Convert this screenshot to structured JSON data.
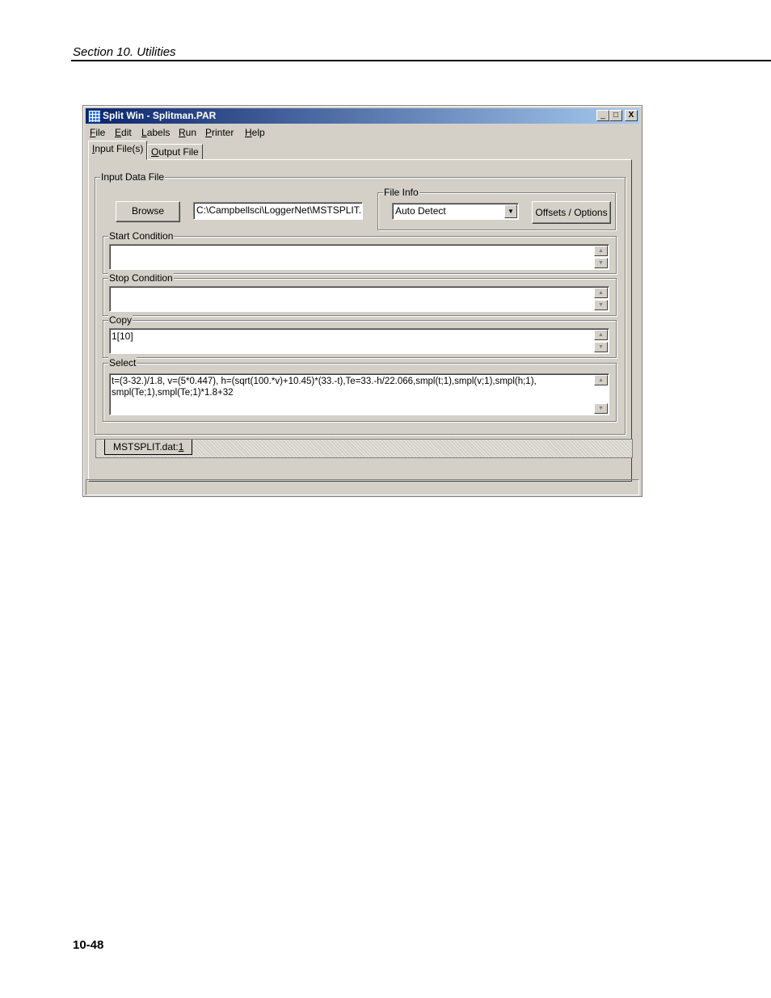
{
  "page": {
    "section_header": "Section 10.  Utilities",
    "page_number": "10-48"
  },
  "window": {
    "title": "Split Win - Splitman.PAR",
    "controls": {
      "minimize": "_",
      "maximize": "□",
      "close": "X"
    }
  },
  "menu": [
    {
      "accel": "F",
      "rest": "ile"
    },
    {
      "accel": "E",
      "rest": "dit"
    },
    {
      "accel": "L",
      "rest": "abels"
    },
    {
      "accel": "R",
      "rest": "un"
    },
    {
      "accel": "P",
      "rest": "rinter"
    },
    {
      "accel": "H",
      "rest": "elp"
    }
  ],
  "tabs": {
    "input": {
      "accel": "I",
      "rest": "nput File(s)"
    },
    "output": {
      "accel": "O",
      "rest": "utput File"
    }
  },
  "input_data_file": {
    "group_label": "Input Data File",
    "browse_label": "Browse",
    "path_value": "C:\\Campbellsci\\LoggerNet\\MSTSPLIT.",
    "file_info_label": "File Info",
    "file_info_selected": "Auto Detect",
    "offsets_button": "Offsets / Options"
  },
  "start_condition": {
    "label": "Start Condition",
    "value": ""
  },
  "stop_condition": {
    "label": "Stop Condition",
    "value": ""
  },
  "copy": {
    "label": "Copy",
    "value": "1[10]"
  },
  "select": {
    "label": "Select",
    "line1": "t=(3-32.)/1.8, v=(5*0.447), h=(sqrt(100.*v)+10.45)*(33.-t),Te=33.-h/22.066,smpl(t;1),smpl(v;1),smpl(h;1),",
    "line2": "smpl(Te;1),smpl(Te;1)*1.8+32"
  },
  "file_tab": {
    "name": "MSTSPLIT.dat:",
    "index": "1"
  }
}
